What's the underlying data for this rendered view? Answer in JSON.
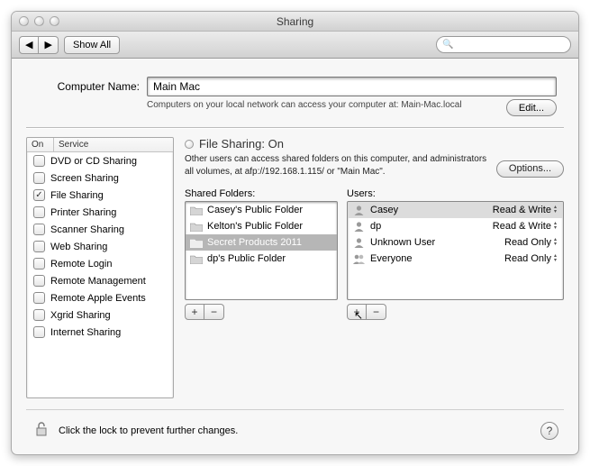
{
  "window_title": "Sharing",
  "toolbar": {
    "back_tip": "Back",
    "forward_tip": "Forward",
    "show_all": "Show All",
    "search_placeholder": ""
  },
  "computer_name": {
    "label": "Computer Name:",
    "value": "Main Mac",
    "subtext": "Computers on your local network can access your computer at: Main-Mac.local",
    "edit": "Edit..."
  },
  "services": {
    "head_on": "On",
    "head_service": "Service",
    "items": [
      {
        "on": false,
        "label": "DVD or CD Sharing"
      },
      {
        "on": false,
        "label": "Screen Sharing"
      },
      {
        "on": true,
        "label": "File Sharing"
      },
      {
        "on": false,
        "label": "Printer Sharing"
      },
      {
        "on": false,
        "label": "Scanner Sharing"
      },
      {
        "on": false,
        "label": "Web Sharing"
      },
      {
        "on": false,
        "label": "Remote Login"
      },
      {
        "on": false,
        "label": "Remote Management"
      },
      {
        "on": false,
        "label": "Remote Apple Events"
      },
      {
        "on": false,
        "label": "Xgrid Sharing"
      },
      {
        "on": false,
        "label": "Internet Sharing"
      }
    ]
  },
  "file_sharing": {
    "title": "File Sharing: On",
    "description": "Other users can access shared folders on this computer, and administrators all volumes, at afp://192.168.1.115/ or \"Main Mac\".",
    "options": "Options...",
    "shared_folders_label": "Shared Folders:",
    "users_label": "Users:",
    "folders": [
      {
        "label": "Casey's Public Folder",
        "selected": false
      },
      {
        "label": "Kelton's Public Folder",
        "selected": false
      },
      {
        "label": "Secret Products 2011",
        "selected": true
      },
      {
        "label": "dp's Public Folder",
        "selected": false
      }
    ],
    "users": [
      {
        "icon": "person",
        "name": "Casey",
        "perm": "Read & Write",
        "hl": true
      },
      {
        "icon": "person",
        "name": "dp",
        "perm": "Read & Write",
        "hl": false
      },
      {
        "icon": "person",
        "name": "Unknown User",
        "perm": "Read Only",
        "hl": false
      },
      {
        "icon": "group",
        "name": "Everyone",
        "perm": "Read Only",
        "hl": false
      }
    ]
  },
  "footer": {
    "lock_text": "Click the lock to prevent further changes."
  },
  "glyphs": {
    "back": "◀",
    "forward": "▶",
    "search": "🔍",
    "check": "✓",
    "plus": "+",
    "minus": "−",
    "up": "▴",
    "down": "▾",
    "help": "?",
    "cursor": "↖"
  }
}
